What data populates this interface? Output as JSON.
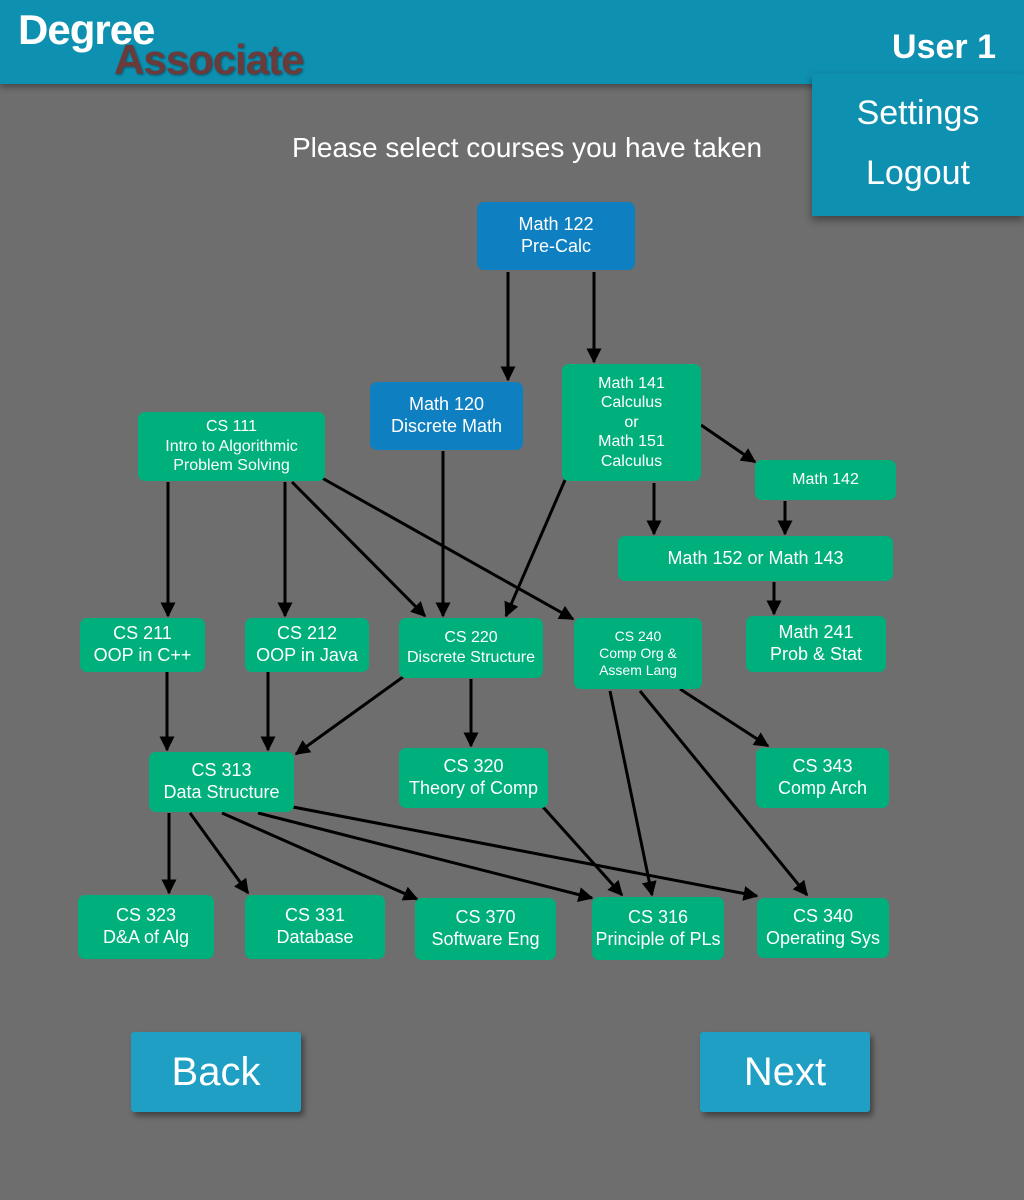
{
  "header": {
    "logo_line1": "Degree",
    "logo_line2": "Associate",
    "user_label": "User 1"
  },
  "user_menu": {
    "settings": "Settings",
    "logout": "Logout"
  },
  "prompt": "Please select courses you have taken",
  "courses": {
    "math122": [
      "Math 122",
      "Pre-Calc"
    ],
    "math120": [
      "Math 120",
      "Discrete Math"
    ],
    "math141": [
      "Math 141",
      "Calculus",
      "or",
      "Math 151",
      "Calculus"
    ],
    "math142": [
      "Math 142"
    ],
    "math152": [
      "Math 152 or Math 143"
    ],
    "cs111": [
      "CS 111",
      "Intro to Algorithmic",
      "Problem Solving"
    ],
    "cs211": [
      "CS 211",
      "OOP in C++"
    ],
    "cs212": [
      "CS 212",
      "OOP in Java"
    ],
    "cs220": [
      "CS 220",
      "Discrete Structure"
    ],
    "cs240": [
      "CS 240",
      "Comp Org &",
      "Assem Lang"
    ],
    "math241": [
      "Math 241",
      "Prob & Stat"
    ],
    "cs313": [
      "CS 313",
      "Data Structure"
    ],
    "cs320": [
      "CS 320",
      "Theory of Comp"
    ],
    "cs343": [
      "CS 343",
      "Comp Arch"
    ],
    "cs323": [
      "CS 323",
      "D&A of Alg"
    ],
    "cs331": [
      "CS 331",
      "Database"
    ],
    "cs370": [
      "CS 370",
      "Software Eng"
    ],
    "cs316": [
      "CS 316",
      "Principle of PLs"
    ],
    "cs340": [
      "CS 340",
      "Operating Sys"
    ]
  },
  "buttons": {
    "back": "Back",
    "next": "Next"
  },
  "colors": {
    "header_bg": "#0e90b0",
    "page_bg": "#6e6e6e",
    "course_green": "#00b07c",
    "course_blue": "#0e7fc0",
    "button_bg": "#1e9fc3"
  }
}
